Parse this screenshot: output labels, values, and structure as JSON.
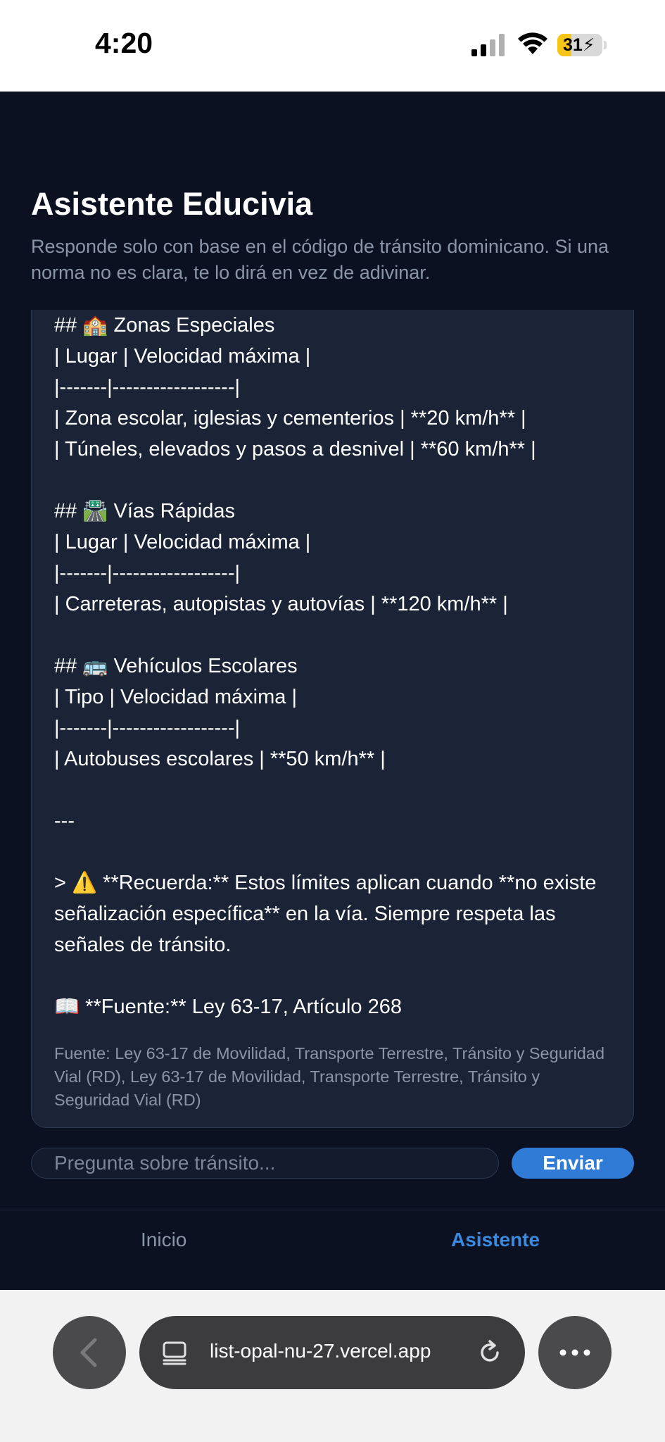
{
  "status_bar": {
    "time": "4:20",
    "battery_level": "31",
    "battery_color": "#f5c518"
  },
  "header": {
    "title": "Asistente Educivia",
    "subtitle": "Responde solo con base en el código de tránsito dominicano. Si una norma no es clara, te lo dirá en vez de adivinar."
  },
  "chat": {
    "message_lines": [
      "## 🏫 Zonas Especiales",
      "| Lugar | Velocidad máxima |",
      "|-------|------------------|",
      "| Zona escolar, iglesias y cementerios | **20 km/h** |",
      "| Túneles, elevados y pasos a desnivel | **60 km/h** |",
      "",
      "## 🛣️ Vías Rápidas",
      "| Lugar | Velocidad máxima |",
      "|-------|------------------|",
      "| Carreteras, autopistas y autovías | **120 km/h** |",
      "",
      "## 🚌 Vehículos Escolares",
      "| Tipo | Velocidad máxima |",
      "|-------|------------------|",
      "| Autobuses escolares | **50 km/h** |",
      "",
      "---",
      "",
      "> ⚠️ **Recuerda:** Estos límites aplican cuando **no existe señalización específica** en la vía. Siempre respeta las señales de tránsito.",
      "",
      "📖 **Fuente:** Ley 63-17, Artículo 268"
    ],
    "source_note": "Fuente: Ley 63-17 de Movilidad, Transporte Terrestre, Tránsito y Seguridad Vial (RD), Ley 63-17 de Movilidad, Transporte Terrestre, Tránsito y Seguridad Vial (RD)"
  },
  "composer": {
    "placeholder": "Pregunta sobre tránsito...",
    "value": "",
    "send_label": "Enviar"
  },
  "nav": {
    "items": [
      {
        "label": "Inicio",
        "active": false
      },
      {
        "label": "Asistente",
        "active": true
      }
    ]
  },
  "browser": {
    "url": "list-opal-nu-27.vercel.app"
  },
  "colors": {
    "background": "#0b1120",
    "card": "#1b2436",
    "accent": "#2f7bd6",
    "muted_text": "#8b95a8"
  }
}
